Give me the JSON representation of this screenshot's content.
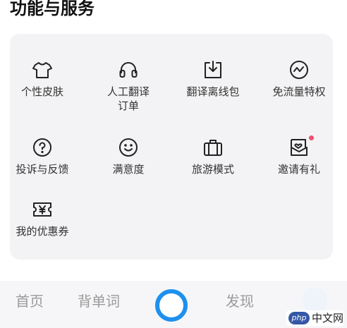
{
  "section": {
    "title": "功能与服务"
  },
  "grid": {
    "items": [
      {
        "icon": "tshirt-icon",
        "label": "个性皮肤"
      },
      {
        "icon": "headphones-icon",
        "label": "人工翻译\n订单"
      },
      {
        "icon": "download-tray-icon",
        "label": "翻译离线包"
      },
      {
        "icon": "trend-circle-icon",
        "label": "免流量特权"
      },
      {
        "icon": "question-circle-icon",
        "label": "投诉与反馈"
      },
      {
        "icon": "smiley-icon",
        "label": "满意度"
      },
      {
        "icon": "suitcase-icon",
        "label": "旅游模式"
      },
      {
        "icon": "envelope-heart-icon",
        "label": "邀请有礼",
        "badge": true
      },
      {
        "icon": "yen-ticket-icon",
        "label": "我的优惠券"
      }
    ]
  },
  "bottom_nav": {
    "tabs": [
      {
        "label": "首页"
      },
      {
        "label": "背单词"
      },
      {
        "label": "发现"
      }
    ]
  },
  "watermark": {
    "logo": "php",
    "text": "中文网"
  },
  "colors": {
    "accent": "#1e90ee",
    "badge": "#f0506e",
    "panel": "#f3f3f5"
  }
}
